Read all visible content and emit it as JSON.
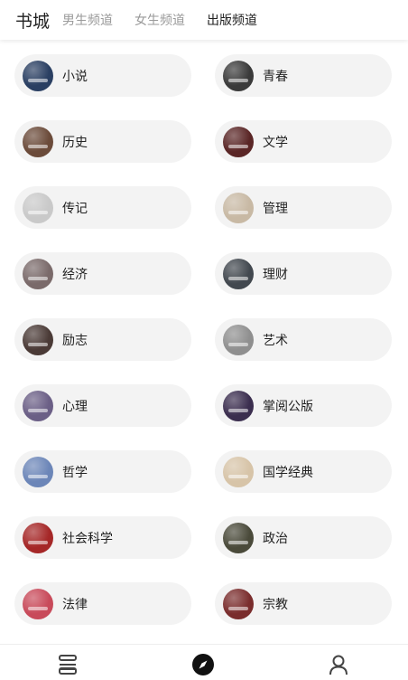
{
  "header": {
    "title": "书城",
    "tabs": [
      {
        "label": "男生频道",
        "active": false
      },
      {
        "label": "女生频道",
        "active": false
      },
      {
        "label": "出版频道",
        "active": true
      }
    ]
  },
  "categories": [
    {
      "label": "小说",
      "cover": "#2a3f62"
    },
    {
      "label": "青春",
      "cover": "#3a3a3a"
    },
    {
      "label": "历史",
      "cover": "#6b4b3a"
    },
    {
      "label": "文学",
      "cover": "#5a2626"
    },
    {
      "label": "传记",
      "cover": "#c9c9c9"
    },
    {
      "label": "管理",
      "cover": "#c8b9a4"
    },
    {
      "label": "经济",
      "cover": "#7a6a6a"
    },
    {
      "label": "理财",
      "cover": "#42484f"
    },
    {
      "label": "励志",
      "cover": "#4a3a36"
    },
    {
      "label": "艺术",
      "cover": "#8f8f8f"
    },
    {
      "label": "心理",
      "cover": "#6b5f86"
    },
    {
      "label": "掌阅公版",
      "cover": "#3b2e4f"
    },
    {
      "label": "哲学",
      "cover": "#6c86b8"
    },
    {
      "label": "国学经典",
      "cover": "#d7c4a8"
    },
    {
      "label": "社会科学",
      "cover": "#a52727"
    },
    {
      "label": "政治",
      "cover": "#4a4a3a"
    },
    {
      "label": "法律",
      "cover": "#c84a5a"
    },
    {
      "label": "宗教",
      "cover": "#7a2d2d"
    }
  ],
  "bottom_nav": {
    "items": [
      {
        "name": "bookshelf-icon"
      },
      {
        "name": "compass-icon",
        "active": true
      },
      {
        "name": "profile-icon"
      }
    ]
  }
}
